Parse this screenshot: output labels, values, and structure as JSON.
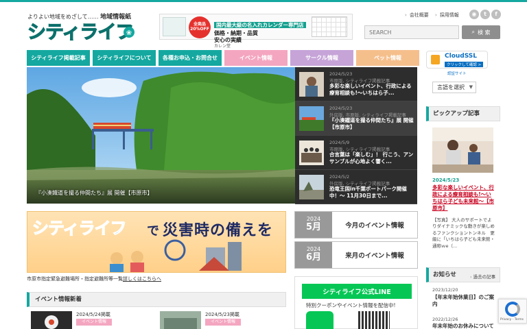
{
  "header": {
    "tagline_prefix": "よりよい地域をめざして……",
    "tagline_bold": "地域情報紙",
    "logo_text": "シティライフ",
    "links": [
      "会社概要",
      "採用情報"
    ],
    "social_icons": [
      "rss-icon",
      "twitter-icon",
      "facebook-icon"
    ],
    "search_placeholder": "SEARCH",
    "search_button": "検 索"
  },
  "ad_banner": {
    "badge": [
      "全商品",
      "20%OFF"
    ],
    "headline": "国内最大級の名入れカレンダー専門店",
    "line2": "価格・納期・品質",
    "line3": "安心の実績",
    "shop": "カレン堂"
  },
  "nav": [
    {
      "label": "シティライフ掲載記事",
      "color": "#14a8a0"
    },
    {
      "label": "シティライフについて",
      "color": "#14a8a0"
    },
    {
      "label": "各種お申込・お問合せ",
      "color": "#14a8a0"
    },
    {
      "label": "イベント情報",
      "color": "#f4a6c0"
    },
    {
      "label": "サークル情報",
      "color": "#c6a4d8"
    },
    {
      "label": "ペット情報",
      "color": "#f5bf8c"
    }
  ],
  "hero": {
    "caption": "『小湊鐵道を撮る仲間たち』展 開催【市原市】"
  },
  "feed": [
    {
      "date": "2024/5/23",
      "category": "市原版, シティライフ掲載記事",
      "title": "多彩な楽しいイベント、行政による療育相談も!〜いちはら子..."
    },
    {
      "date": "2024/5/23",
      "category": "外房版, 市原版, シティライフ掲載記事",
      "title": "『小湊鐵道を撮る仲間たち』展 開催【市原市】"
    },
    {
      "date": "2024/5/9",
      "category": "市原版, シティライフ掲載記事",
      "title": "合言葉は「楽しむ」！ 行こう、アンサンブルが心地よく響く..."
    },
    {
      "date": "2024/5/2",
      "category": "外房版, シティライフ掲載記事",
      "title": "恐竜王国in千葉ポートパーク開催中！〜 11月30日まで..."
    }
  ],
  "disaster": {
    "logo_text": "シティライフ",
    "connector": "で",
    "headline": "災害時の備えを",
    "note_prefix": "市原市指定緊急避難場所・指定避難所等一覧",
    "note_link": "詳しくはこちらへ"
  },
  "months": [
    {
      "year": "2024",
      "month": "5月",
      "label": "今月のイベント情報"
    },
    {
      "year": "2024",
      "month": "6月",
      "label": "来月のイベント情報"
    }
  ],
  "events": {
    "heading": "イベント情報新着",
    "cards": [
      {
        "date": "2024/5/24掲載",
        "tag": "イベント情報"
      },
      {
        "date": "2024/5/23掲載",
        "tag": "イベント情報"
      }
    ]
  },
  "line": {
    "heading": "シティライフ公式LINE",
    "sub": "特別クーポンやイベント情報を配信中!"
  },
  "sidebar": {
    "ssl_name": "CloudSSL",
    "ssl_sub": "クリックして確認 >",
    "ssl_note": "認証サイト",
    "lang_select": "言語を選択",
    "pickup_heading": "ピックアップ記事",
    "pickup_date": "2024/5/23",
    "pickup_title": "多彩な楽しいイベント、行政による療育相談も!〜いちはら子ども未来館〜【市原市】",
    "pickup_desc": "【写真】 大人のサポートでよりダイナミックな動きが楽しめるファンクショントンネル　更級に「いちはら子ども未来館・通称ｗe（...",
    "news_heading": "お知らせ",
    "news_more": "過去の記事",
    "news": [
      {
        "date": "2023/12/20",
        "title": "【年末年始休業日】のご案内"
      },
      {
        "date": "2022/12/26",
        "title": "年末年始のお休みについて"
      }
    ]
  },
  "recaptcha": {
    "text": "Privacy - Terms"
  },
  "colors": {
    "accent": "#14a8a0",
    "event_pink": "#f4a6c0",
    "circle_purple": "#c6a4d8",
    "pet_orange": "#f5bf8c",
    "line_green": "#06c755"
  }
}
